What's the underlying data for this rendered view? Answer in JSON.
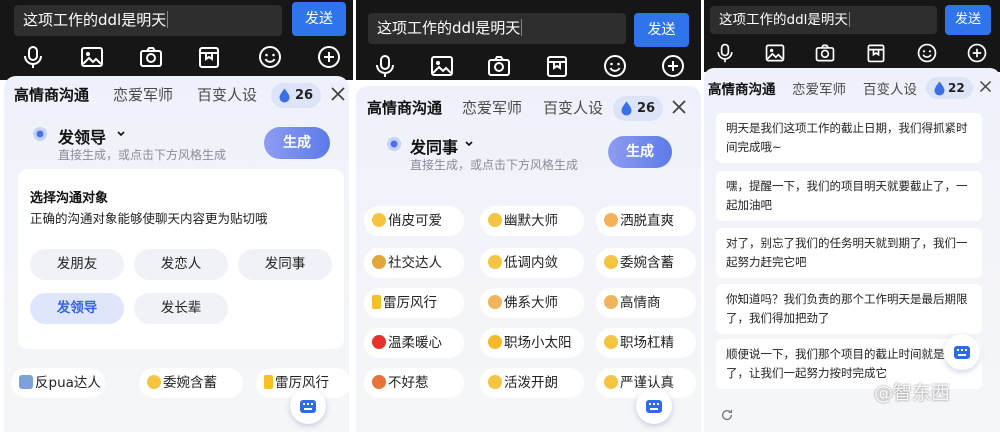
{
  "input": {
    "text": "这项工作的ddl是明天"
  },
  "send_label": "发送",
  "toolbar_icons": [
    "mic-icon",
    "image-icon",
    "camera-icon",
    "bookmark-box-icon",
    "emoji-icon",
    "plus-icon"
  ],
  "tabs": [
    "高情商沟通",
    "恋爱军师",
    "百变人设"
  ],
  "credits": {
    "panel1": "26",
    "panel2": "26",
    "panel3": "22"
  },
  "panel1": {
    "target": "发领导",
    "hint": "直接生成，或点击下方风格生成",
    "generate_label": "生成",
    "choose_title": "选择沟通对象",
    "choose_desc": "正确的沟通对象能够使聊天内容更为贴切哦",
    "options": [
      "发朋友",
      "发恋人",
      "发同事",
      "发领导",
      "发长辈"
    ],
    "chips": [
      "反pua达人",
      "委婉含蓄",
      "雷厉风行"
    ]
  },
  "panel2": {
    "target": "发同事",
    "hint": "直接生成，或点击下方风格生成",
    "generate_label": "生成",
    "styles": [
      "俏皮可爱",
      "幽默大师",
      "洒脱直爽",
      "社交达人",
      "低调内敛",
      "委婉含蓄",
      "雷厉风行",
      "佛系大师",
      "高情商",
      "温柔暖心",
      "职场小太阳",
      "职场杠精",
      "不好惹",
      "活泼开朗",
      "严谨认真"
    ]
  },
  "panel3": {
    "replies": [
      "明天是我们这项工作的截止日期，我们得抓紧时间完成哦~",
      "嘿，提醒一下，我们的项目明天就要截止了，一起加油吧",
      "对了，别忘了我们的任务明天就到期了，我们一起努力赶完它吧",
      "你知道吗？我们负责的那个工作明天是最后期限了，我们得加把劲了",
      "顺便说一下，我们那个项目的截止时间就是明天了，让我们一起努力按时完成它"
    ]
  },
  "watermark": "@智东西",
  "colors": {
    "accent": "#2f74ea",
    "topbar": "#161616",
    "selected_option": "#3464e0"
  }
}
